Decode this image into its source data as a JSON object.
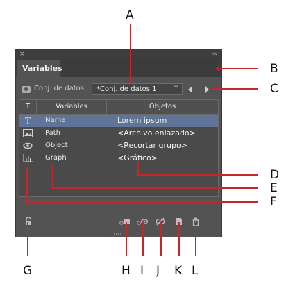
{
  "callouts": {
    "a": "A",
    "b": "B",
    "c": "C",
    "d": "D",
    "e": "E",
    "f": "F",
    "g": "G",
    "h": "H",
    "i": "I",
    "j": "J",
    "k": "K",
    "l": "L"
  },
  "panel": {
    "title_close": "×",
    "title_collapse": "‹‹",
    "tab_label": "Variables",
    "dataset_label": "Conj. de datos:",
    "dataset_value": "*Conj. de datos 1",
    "table": {
      "headers": [
        "T",
        "Variables",
        "Objetos"
      ],
      "rows": [
        {
          "icon": "text-variable-icon",
          "name": "Name",
          "object": "Lorem ipsum",
          "selected": true
        },
        {
          "icon": "image-variable-icon",
          "name": "Path",
          "object": "<Archivo enlazado>",
          "selected": false
        },
        {
          "icon": "visibility-variable-icon",
          "name": "Object",
          "object": "<Recortar grupo>",
          "selected": false
        },
        {
          "icon": "graph-variable-icon",
          "name": "Graph",
          "object": "<Gráfico>",
          "selected": false
        }
      ]
    }
  },
  "colors": {
    "accent_red": "#c2272d",
    "panel_bg": "#535353",
    "selected_row": "#5f7497"
  }
}
